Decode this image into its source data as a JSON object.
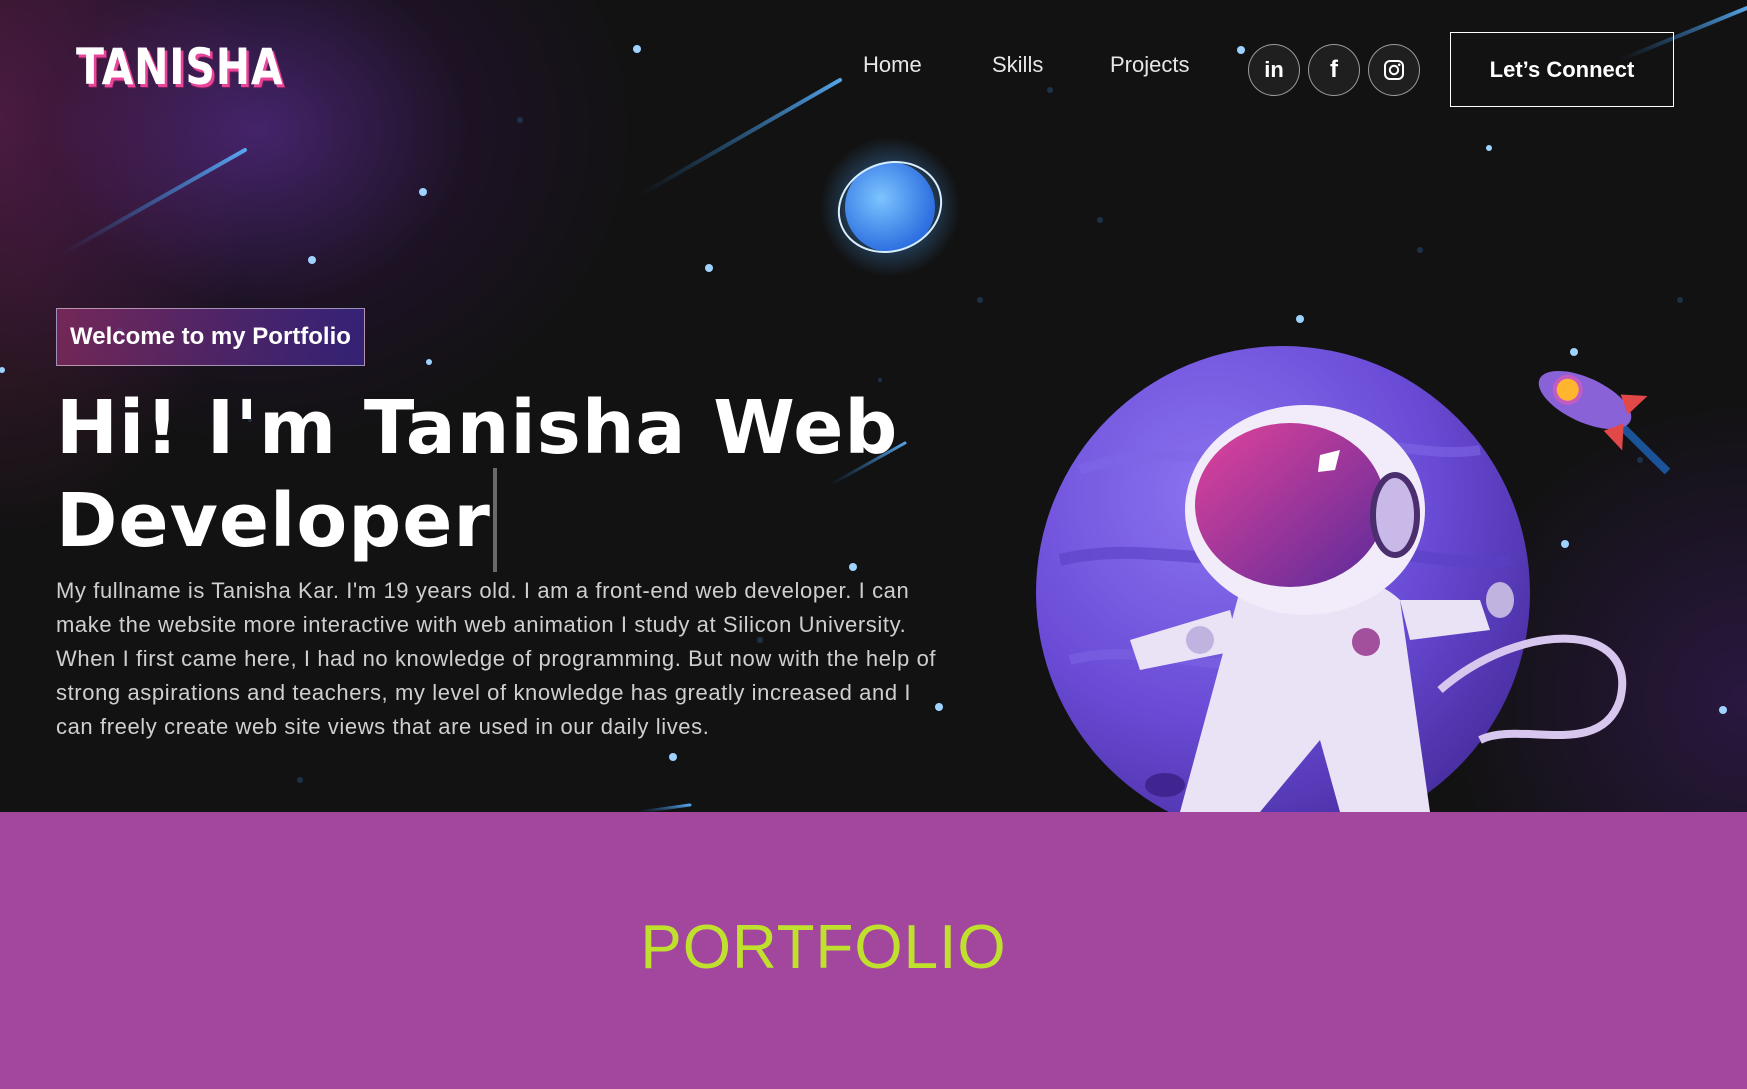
{
  "brand": {
    "logo_text": "TANISHA"
  },
  "nav": {
    "links": [
      {
        "label": "Home"
      },
      {
        "label": "Skills"
      },
      {
        "label": "Projects"
      }
    ],
    "social": [
      {
        "icon": "linkedin-icon",
        "glyph": "in"
      },
      {
        "icon": "facebook-icon",
        "glyph": "f"
      },
      {
        "icon": "instagram-icon",
        "glyph": ""
      }
    ],
    "connect_label": "Let’s Connect"
  },
  "hero": {
    "tagline": "Welcome to my Portfolio",
    "headline": "Hi! I'm Tanisha Web Developer",
    "bio": "My fullname is Tanisha Kar. I'm 19 years old. I am a front-end web developer. I can make the website more interactive with web animation I study at Silicon University. When I first came here, I had no knowledge of programming. But now with the help of strong aspirations and teachers, my level of knowledge has greatly increased and I can freely create web site views that are used in our daily lives."
  },
  "portfolio": {
    "title": "PORTFOLIO"
  },
  "colors": {
    "background": "#121212",
    "accent_pink": "#e8459a",
    "portfolio_bg": "#a2469e",
    "portfolio_title": "#bfe12e",
    "planet": "#6a4bd6"
  }
}
